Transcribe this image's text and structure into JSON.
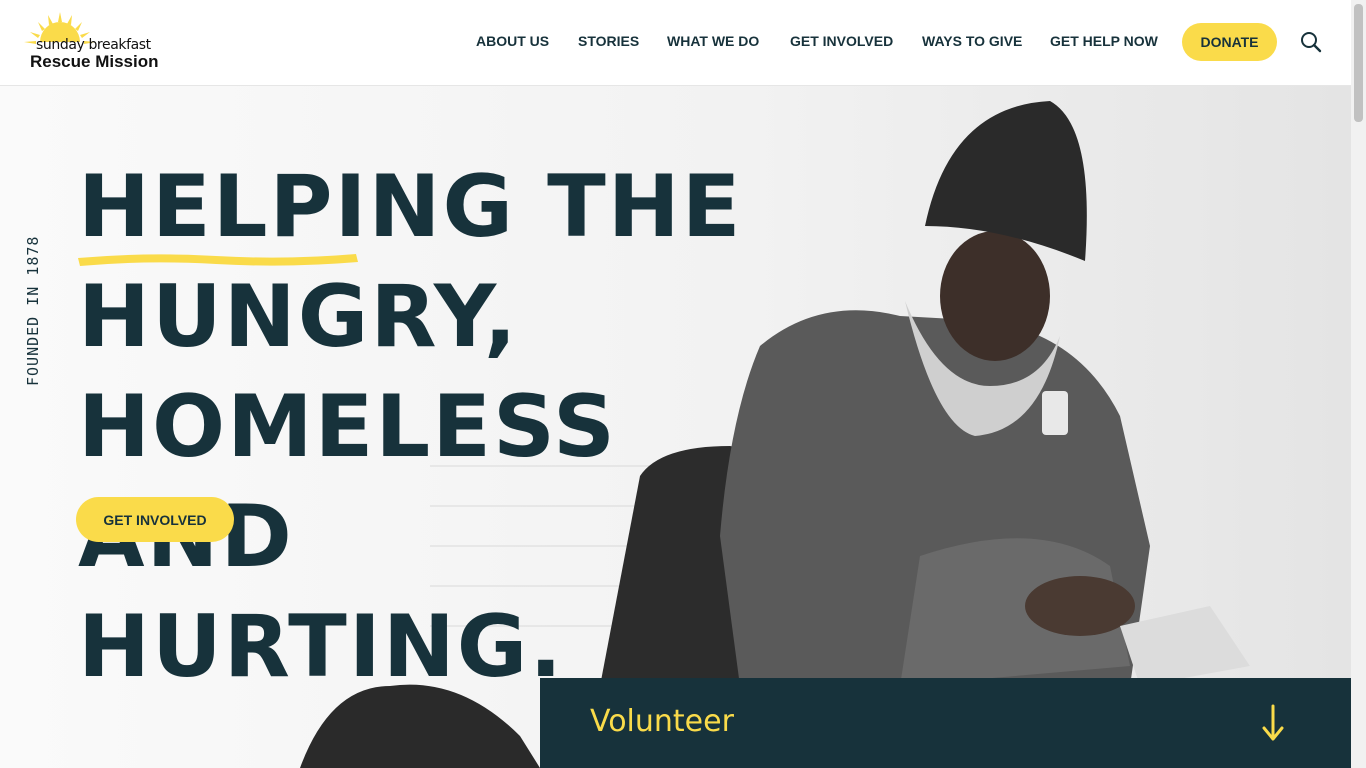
{
  "logo": {
    "line1": "sunday breakfast",
    "line2": "Rescue Mission"
  },
  "nav": {
    "items": [
      {
        "label": "ABOUT US"
      },
      {
        "label": "STORIES"
      },
      {
        "label": "WHAT WE DO"
      },
      {
        "label": "GET INVOLVED"
      },
      {
        "label": "WAYS TO GIVE"
      },
      {
        "label": "GET HELP NOW"
      }
    ],
    "donate_label": "DONATE",
    "search_icon": "search-icon"
  },
  "hero": {
    "founded": "FOUNDED IN 1878",
    "headline_word1": "Helping",
    "headline_rest": " the hungry, homeless and hurting.",
    "cta_label": "GET INVOLVED",
    "volunteer_label": "Volunteer",
    "arrow_icon": "arrow-down-icon"
  },
  "colors": {
    "accent": "#fadb4a",
    "dark": "#17323b",
    "white": "#ffffff"
  }
}
